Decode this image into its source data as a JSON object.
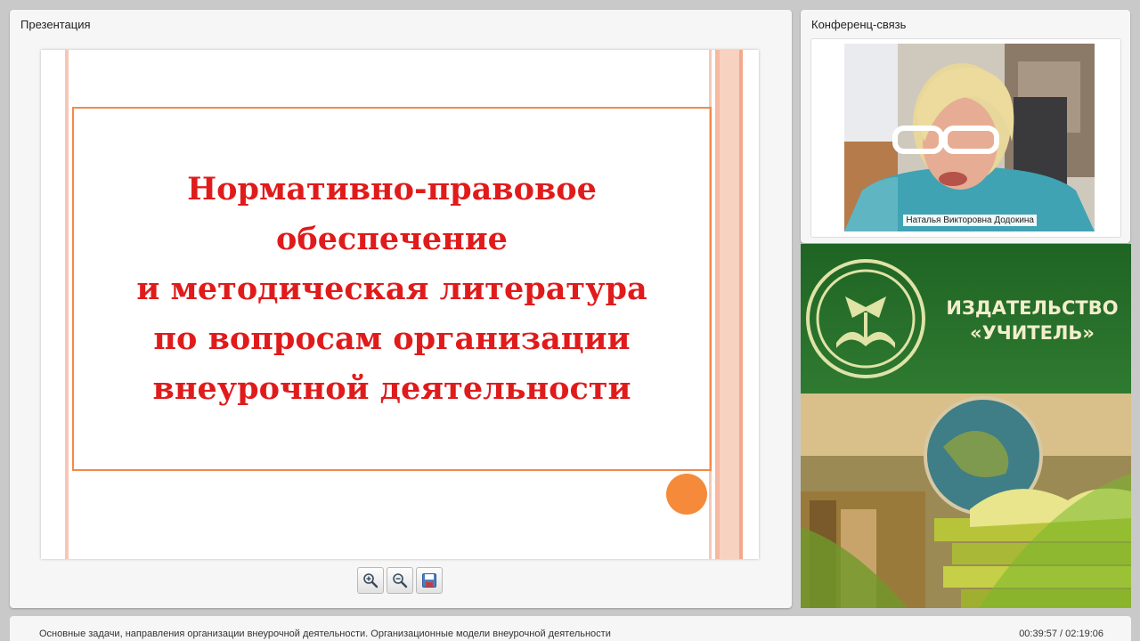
{
  "presentation_panel": {
    "title": "Презентация"
  },
  "slide": {
    "title_lines": [
      "Нормативно-правовое",
      "обеспечение",
      "и методическая литература",
      "по вопросам организации",
      "внеурочной деятельности"
    ],
    "title_color": "#e01b1b",
    "frame_color": "#f08a4b",
    "dot_color": "#f58a3a"
  },
  "toolbar": {
    "buttons": [
      {
        "name": "zoom-in",
        "icon": "zoom-in-icon"
      },
      {
        "name": "zoom-out",
        "icon": "zoom-out-icon"
      },
      {
        "name": "save",
        "icon": "floppy-disk-icon"
      }
    ]
  },
  "conference_panel": {
    "title": "Конференц-связь",
    "speaker_name": "Наталья Викторовна Додокина"
  },
  "publisher_banner": {
    "line1": "ИЗДАТЕЛЬСТВО",
    "line2": "«УЧИТЕЛЬ»",
    "colors": {
      "green": "#2a6d2d",
      "text": "#f3eecc"
    }
  },
  "status_bar": {
    "lesson_title": "Основные задачи, направления организации внеурочной деятельности. Организационные модели внеурочной деятельности",
    "time_current": "00:39:57",
    "time_total": "02:19:06",
    "time_display": "00:39:57 / 02:19:06"
  }
}
